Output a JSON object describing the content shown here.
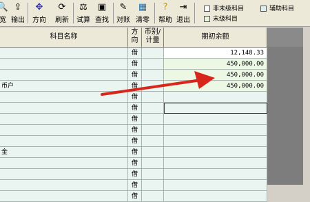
{
  "toolbar": {
    "buttons": [
      {
        "label": "宽",
        "icon": "search-icon"
      },
      {
        "label": "输出",
        "icon": "export-icon"
      },
      {
        "label": "方向",
        "icon": "direction-icon"
      },
      {
        "label": "刷新",
        "icon": "refresh-icon"
      },
      {
        "label": "试算",
        "icon": "balance-scale-icon"
      },
      {
        "label": "查找",
        "icon": "find-icon"
      },
      {
        "label": "对账",
        "icon": "reconcile-icon"
      },
      {
        "label": "清零",
        "icon": "clear-icon"
      },
      {
        "label": "帮助",
        "icon": "help-icon"
      },
      {
        "label": "退出",
        "icon": "exit-icon"
      }
    ],
    "legend": {
      "non_leaf": "非末级科目",
      "auxiliary": "辅助科目",
      "leaf": "末级科目"
    }
  },
  "table": {
    "headers": {
      "name": "科目名称",
      "direction": "方向",
      "currency": "币别/计量",
      "opening_balance": "期初余额"
    },
    "rows": [
      {
        "name": "",
        "direction": "借",
        "amount": "12,148.33"
      },
      {
        "name": "",
        "direction": "借",
        "amount": "450,000.00"
      },
      {
        "name": "",
        "direction": "借",
        "amount": "450,000.00"
      },
      {
        "name": "币户",
        "direction": "借",
        "amount": "450,000.00"
      },
      {
        "name": "",
        "direction": "借",
        "amount": ""
      },
      {
        "name": "",
        "direction": "借",
        "amount": ""
      },
      {
        "name": "",
        "direction": "借",
        "amount": ""
      },
      {
        "name": "",
        "direction": "借",
        "amount": ""
      },
      {
        "name": "",
        "direction": "借",
        "amount": ""
      },
      {
        "name": "金",
        "direction": "借",
        "amount": ""
      },
      {
        "name": "",
        "direction": "借",
        "amount": ""
      },
      {
        "name": "",
        "direction": "借",
        "amount": ""
      },
      {
        "name": "",
        "direction": "借",
        "amount": ""
      },
      {
        "name": "",
        "direction": "借",
        "amount": ""
      }
    ]
  },
  "colors": {
    "arrow": "#d9261c",
    "row_highlight": "#ecf7e4",
    "grid_line": "#a9b5b0"
  }
}
